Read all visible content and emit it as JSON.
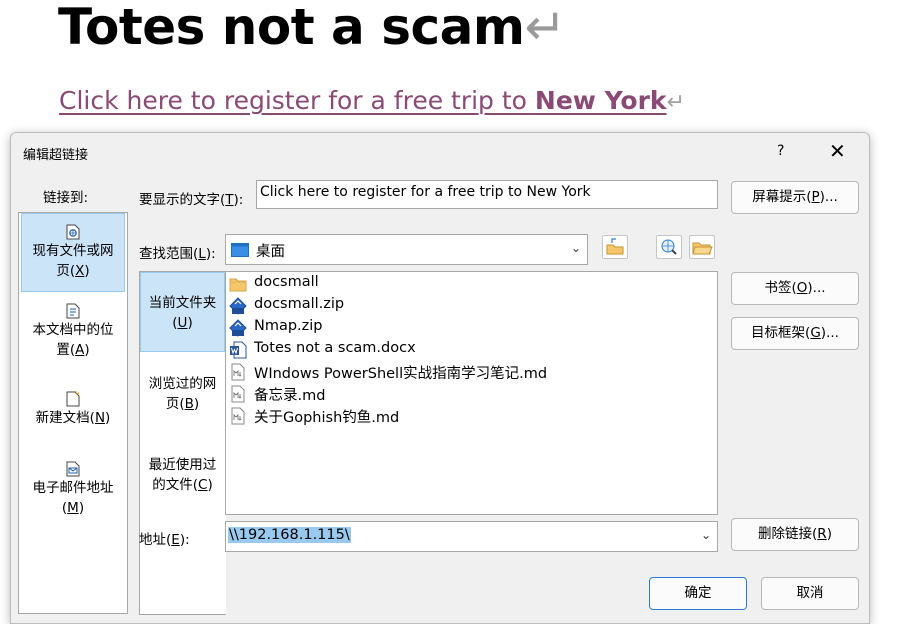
{
  "document": {
    "title": "Totes not a scam",
    "link_prefix": "Click here to register for a free trip to ",
    "link_bold": "New York",
    "return_mark": "↵"
  },
  "dialog": {
    "title": "编辑超链接",
    "help": "?",
    "close": "✕",
    "link_to_label": "链接到:",
    "link_to_items": [
      {
        "line1": "现有文件或网",
        "line2_pre": "页(",
        "key": "X",
        "line2_post": ")",
        "icon": "globe-page-icon"
      },
      {
        "line1": "本文档中的位",
        "line2_pre": "置(",
        "key": "A",
        "line2_post": ")",
        "icon": "document-place-icon"
      },
      {
        "line1": "新建文档(",
        "key": "N",
        "line1_post": ")",
        "icon": "new-document-icon"
      },
      {
        "line1": "电子邮件地址",
        "line2_pre": "(",
        "key": "M",
        "line2_post": ")",
        "icon": "email-icon"
      }
    ],
    "display_text_label_pre": "要显示的文字(",
    "display_text_key": "T",
    "display_text_label_post": "):",
    "display_text_value": "Click here to register for a free trip to New York",
    "screentip_pre": "屏幕提示(",
    "screentip_key": "P",
    "screentip_post": ")...",
    "look_in_label_pre": "查找范围(",
    "look_in_key": "L",
    "look_in_label_post": "):",
    "look_in_value": "桌面",
    "scope_items": [
      {
        "line1": "当前文件夹",
        "line2_pre": "(",
        "key": "U",
        "line2_post": ")"
      },
      {
        "line1": "浏览过的网",
        "line2_pre": "页(",
        "key": "B",
        "line2_post": ")"
      },
      {
        "line1": "最近使用过",
        "line2_pre": "的文件(",
        "key": "C",
        "line2_post": ")"
      }
    ],
    "files": [
      {
        "name": "docsmall",
        "icon": "folder-icon"
      },
      {
        "name": "docsmall.zip",
        "icon": "zip-icon"
      },
      {
        "name": "Nmap.zip",
        "icon": "zip-icon"
      },
      {
        "name": "Totes not a scam.docx",
        "icon": "word-doc-icon"
      },
      {
        "name": "WIndows PowerShell实战指南学习笔记.md",
        "icon": "markdown-file-icon"
      },
      {
        "name": "备忘录.md",
        "icon": "markdown-file-icon"
      },
      {
        "name": "关于Gophish钓鱼.md",
        "icon": "markdown-file-icon"
      }
    ],
    "bookmark_pre": "书签(",
    "bookmark_key": "O",
    "bookmark_post": ")...",
    "target_frame_pre": "目标框架(",
    "target_frame_key": "G",
    "target_frame_post": ")...",
    "address_label_pre": "地址(",
    "address_key": "E",
    "address_label_post": "):",
    "address_value": "\\\\192.168.1.115\\",
    "remove_link_pre": "删除链接(",
    "remove_link_key": "R",
    "remove_link_post": ")",
    "ok_label": "确定",
    "cancel_label": "取消"
  },
  "colors": {
    "link": "#8a4a75",
    "selection": "#cce4f7",
    "accent_border": "#2a7fd4"
  }
}
